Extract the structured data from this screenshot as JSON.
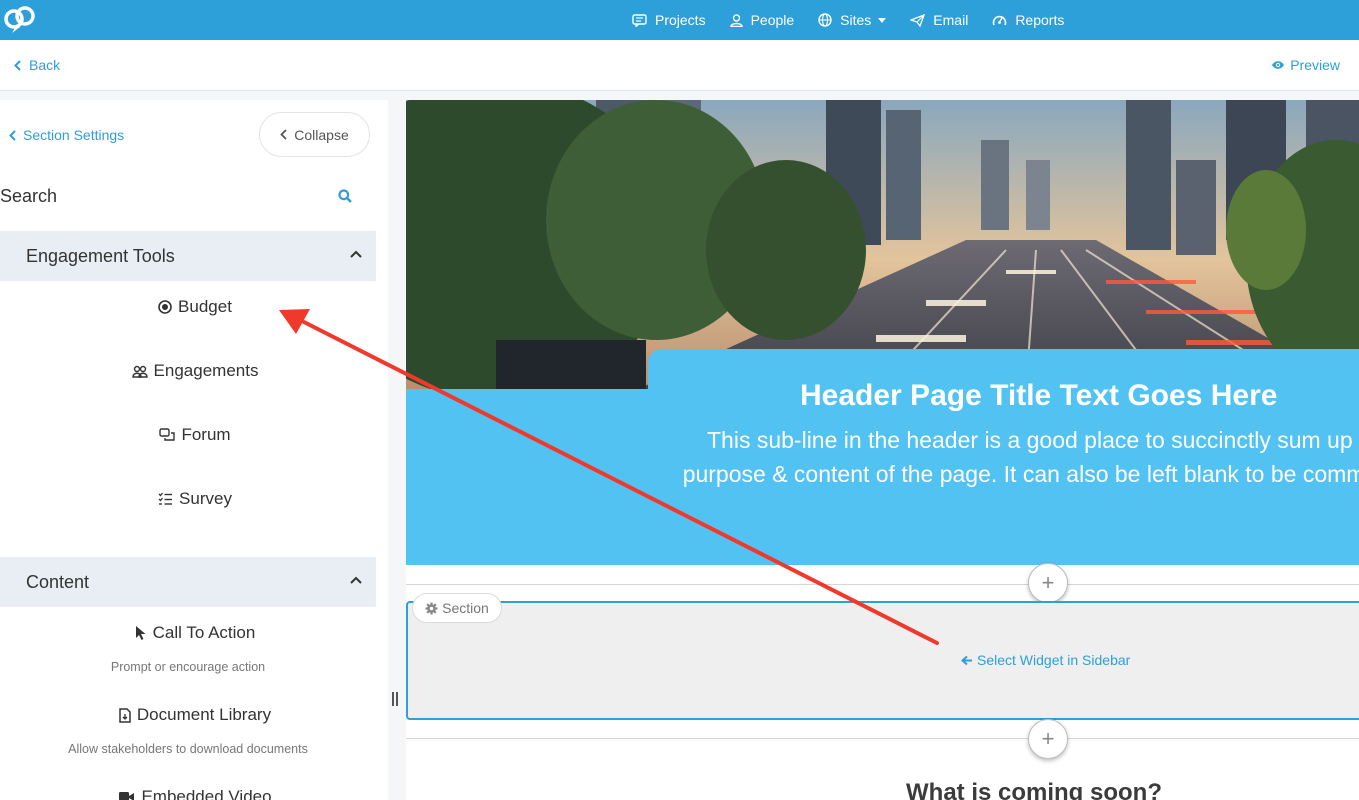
{
  "nav": {
    "items": [
      {
        "label": "Projects",
        "icon": "chat-icon"
      },
      {
        "label": "People",
        "icon": "person-icon"
      },
      {
        "label": "Sites",
        "icon": "globe-icon"
      },
      {
        "label": "Email",
        "icon": "send-icon"
      },
      {
        "label": "Reports",
        "icon": "chart-icon"
      }
    ]
  },
  "subbar": {
    "back_label": "Back",
    "preview_label": "Preview"
  },
  "sidebar": {
    "section_settings": "Section Settings",
    "collapse": "Collapse",
    "search_label": "Search",
    "groups": [
      {
        "title": "Engagement Tools",
        "items": [
          {
            "label": "Budget",
            "icon": "budget-icon"
          },
          {
            "label": "Engagements",
            "icon": "engagements-icon"
          },
          {
            "label": "Forum",
            "icon": "forum-icon"
          },
          {
            "label": "Survey",
            "icon": "survey-icon"
          }
        ]
      },
      {
        "title": "Content",
        "items": [
          {
            "label": "Call To Action",
            "icon": "cursor-icon",
            "desc": "Prompt or encourage action"
          },
          {
            "label": "Document Library",
            "icon": "document-icon",
            "desc": "Allow stakeholders to download documents"
          },
          {
            "label": "Embedded Video",
            "icon": "video-icon"
          }
        ]
      }
    ]
  },
  "canvas": {
    "title": "Header Page Title Text Goes Here",
    "subtitle": "This sub-line in the header is a good place to succinctly sum up the purpose & content of the page. It can also be left blank to be committed.",
    "section_tag": "Section",
    "select_widget": "Select Widget in Sidebar",
    "coming_soon": "What is coming soon?"
  },
  "colors": {
    "accent": "#2d9fd9",
    "header_band": "#52c2f2",
    "annotation_arrow": "#f0392b"
  }
}
